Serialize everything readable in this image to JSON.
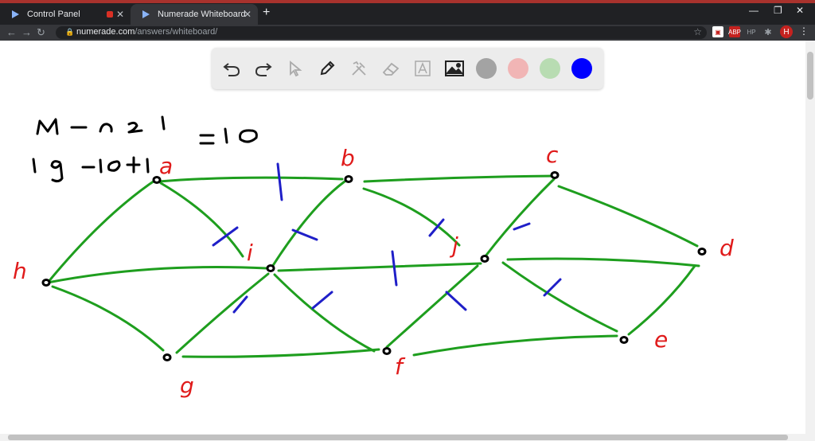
{
  "browser": {
    "tabs": [
      {
        "title": "Control Panel",
        "active": false
      },
      {
        "title": "Numerade Whiteboard",
        "active": true
      }
    ],
    "new_tab_icon": "plus-icon",
    "url_domain": "numerade.com",
    "url_path": "/answers/whiteboard/",
    "profile_initial": "H",
    "ext_abp": "ABP",
    "ext_hp": "HP"
  },
  "toolbar": {
    "tools": [
      "undo-icon",
      "redo-icon",
      "pointer-icon",
      "pen-icon",
      "tools-icon",
      "eraser-icon",
      "text-icon",
      "image-icon"
    ],
    "colors": {
      "gray": "#a3a3a3",
      "pink": "#f1b5b5",
      "green": "#b8dcb2",
      "blue": "#0000ff"
    }
  },
  "whiteboard": {
    "handwriting": {
      "line1": "M - n + 1",
      "line2": "19 - 10 + 1",
      "result": "= 10"
    },
    "node_labels": {
      "a": "a",
      "b": "b",
      "c": "c",
      "d": "d",
      "e": "e",
      "f": "f",
      "g": "g",
      "h": "h",
      "i": "i",
      "j": "j"
    },
    "colors": {
      "edge": "#1e9e1e",
      "tick": "#1f1fc8",
      "label": "#e01b1b",
      "ink": "#000000"
    }
  }
}
